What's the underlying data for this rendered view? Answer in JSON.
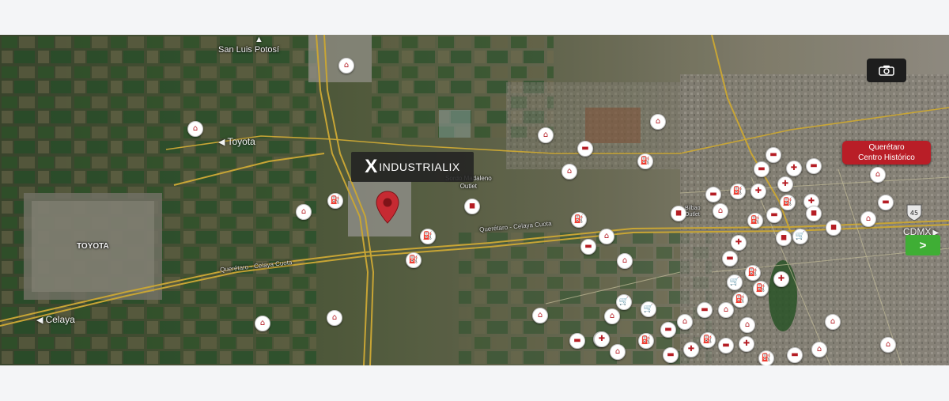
{
  "map": {
    "brand": {
      "x_mark": "X",
      "name": "INDUSTRIALIX"
    },
    "highlight_label": {
      "line1": "Querétaro",
      "line2": "Centro Histórico"
    },
    "place_labels": {
      "san_luis": "San Luis Potosí",
      "toyota_direction": "Toyota",
      "celaya_direction": "Celaya",
      "cdmx_direction": "CDMX",
      "toyota_plant": "TOYOTA",
      "sordo_line1": "Sordo Madaleno",
      "sordo_line2": "Outlet",
      "road_1": "Querétaro - Celaya Cuota",
      "road_2": "Querétaro - Celaya Cuota",
      "misc_1": "Bilbao",
      "misc_2": "Outlet"
    },
    "highway_shield": "45",
    "icons": {
      "home": "⌂",
      "health": "✚",
      "shop": "🛒",
      "gas": "⛽",
      "bus": "▬",
      "bag": "◼"
    },
    "colors": {
      "accent_red": "#b91e27",
      "next_green": "#3fae35"
    }
  }
}
